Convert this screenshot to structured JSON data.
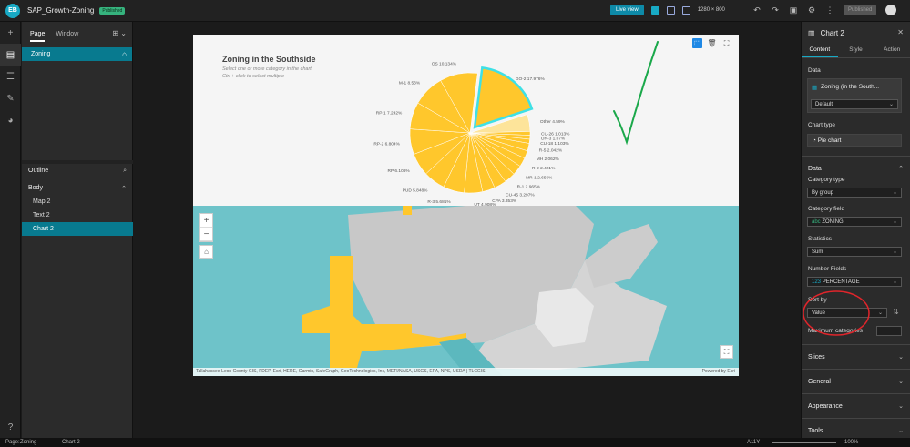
{
  "app": {
    "logo": "EB",
    "name": "SAP_Growth-Zoning",
    "badge": "Published"
  },
  "toolbar": {
    "live_view": "Live view",
    "size": "1280 × 800",
    "published": "Published"
  },
  "left_panel": {
    "tabs": [
      "Page",
      "Window"
    ],
    "pages": [
      {
        "label": "Zoning"
      }
    ],
    "outline_label": "Outline",
    "body_label": "Body",
    "outline_items": [
      {
        "label": "Map 2"
      },
      {
        "label": "Text 2"
      },
      {
        "label": "Chart 2"
      }
    ]
  },
  "chart": {
    "title": "Zoning in the Southside",
    "subtitle_1": "Select one or more category in the chart",
    "subtitle_2": "Ctrl + click to select multiple"
  },
  "chart_data": {
    "type": "pie",
    "categories": [
      "GO-2",
      "Other",
      "CU-26",
      "OR-3",
      "CU-18",
      "R-5",
      "MH",
      "R-2",
      "MR-1",
      "R-1",
      "CU-45",
      "CPA",
      "UT",
      "R-3",
      "PUD",
      "RP",
      "RP-2",
      "RP-1",
      "M-1",
      "OS"
    ],
    "values": [
      17.976,
      4.59,
      1.013,
      1.07,
      1.103,
      2.042,
      2.062,
      2.421,
      2.656,
      2.965,
      3.297,
      3.353,
      4.908,
      5.681,
      5.848,
      6.106,
      6.804,
      7.242,
      8.53,
      10.134
    ],
    "labels": [
      "GO-2 17.976%",
      "Other 4.59%",
      "CU-26 1.013%",
      "OR-3 1.07%",
      "CU-18 1.103%",
      "R-5 2.042%",
      "MH 2.062%",
      "R-2 2.421%",
      "MR-1 2.656%",
      "R-1 2.965%",
      "CU-45 3.297%",
      "CPA 3.353%",
      "UT 4.908%",
      "R-3 5.681%",
      "PUD 5.848%",
      "RP 6.106%",
      "RP-2 6.804%",
      "RP-1 7.242%",
      "M-1 8.53%",
      "OS 10.134%"
    ],
    "colors": {
      "slice": "#ffc72c",
      "other": "#fde49a",
      "highlight": "#3ee0e6"
    },
    "selected": "GO-2"
  },
  "map": {
    "attribution": "Tallahassee-Leon County GIS, FDEP, Esri, HERE, Garmin, SafeGraph, GeoTechnologies, Inc, METI/NASA, USGS, EPA, NPS, USDA | TLCGIS",
    "powered": "Powered by Esri",
    "colors": {
      "water": "#6ec3c9",
      "land": "#c8c8c8",
      "zone": "#ffc72c",
      "teal_zone": "#5cb8be"
    }
  },
  "right_panel": {
    "title": "Chart 2",
    "tabs": [
      "Content",
      "Style",
      "Action"
    ],
    "data_label": "Data",
    "data_source": "Zoning (in the South...",
    "data_view": "Default",
    "chart_type_label": "Chart type",
    "chart_type": "Pie chart",
    "data_section": "Data",
    "category_type_label": "Category type",
    "category_type": "By group",
    "category_field_label": "Category field",
    "category_field": "ZONING",
    "statistics_label": "Statistics",
    "statistics": "Sum",
    "number_fields_label": "Number Fields",
    "number_fields": "PERCENTAGE",
    "sort_by_label": "Sort by",
    "sort_by": "Value",
    "max_categories_label": "Maximum categories",
    "sections": [
      "Slices",
      "General",
      "Appearance",
      "Tools"
    ]
  },
  "status_bar": {
    "page_label": "Page:",
    "page": "Zoning",
    "widget": "Chart 2",
    "a11y": "A11Y",
    "zoom": "100%"
  }
}
